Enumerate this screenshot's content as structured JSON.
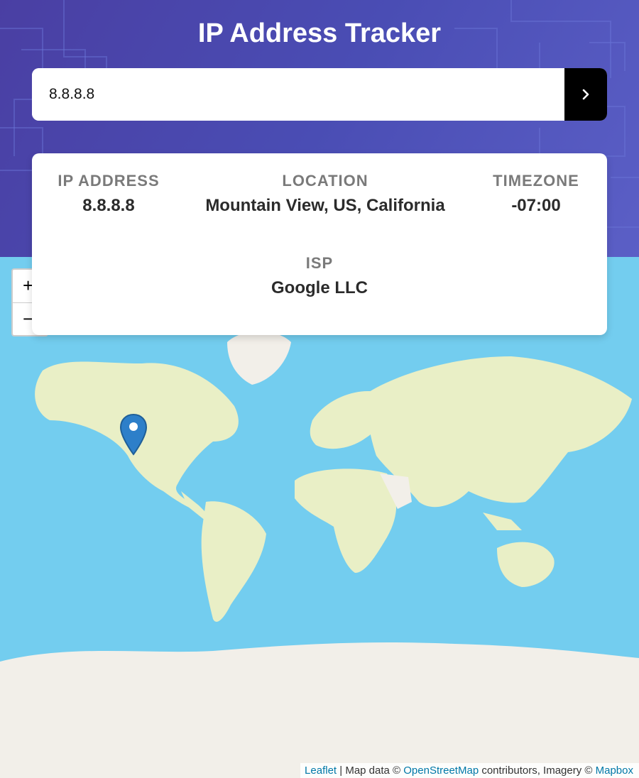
{
  "header": {
    "title": "IP Address Tracker"
  },
  "search": {
    "value": "8.8.8.8",
    "submit_icon": "chevron-right-icon"
  },
  "info": {
    "ip": {
      "label": "IP ADDRESS",
      "value": "8.8.8.8"
    },
    "location": {
      "label": "LOCATION",
      "value": "Mountain View, US, California"
    },
    "timezone": {
      "label": "TIMEZONE",
      "value": "-07:00"
    },
    "isp": {
      "label": "ISP",
      "value": "Google LLC"
    }
  },
  "map": {
    "zoom_in": "+",
    "zoom_out": "−",
    "marker_icon": "map-pin-icon",
    "attribution": {
      "leaflet": "Leaflet",
      "sep": " | Map data © ",
      "osm": "OpenStreetMap",
      "mid": " contributors, Imagery © ",
      "mapbox": "Mapbox"
    },
    "colors": {
      "ocean": "#73cdef",
      "land": "#e9efc6",
      "ice": "#f2efe9"
    }
  },
  "colors": {
    "header_gradient_start": "#4a3fa3",
    "header_gradient_end": "#5b5fc6",
    "button": "#000000",
    "label": "#7a7a7a",
    "value": "#2b2b2b"
  }
}
